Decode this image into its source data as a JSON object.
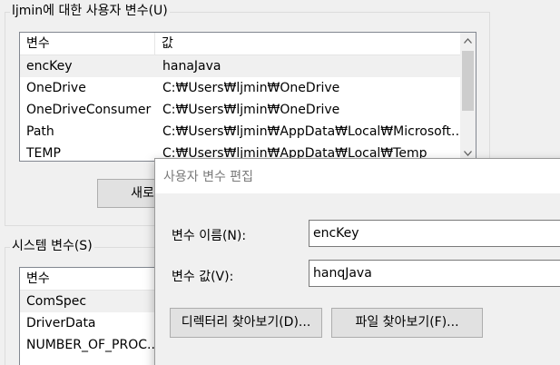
{
  "user_vars": {
    "group_title": "ljmin에 대한 사용자 변수(U)",
    "columns": [
      "변수",
      "값"
    ],
    "rows": [
      {
        "name": "encKey",
        "value": "hanaJava"
      },
      {
        "name": "OneDrive",
        "value": "C:₩Users₩ljmin₩OneDrive"
      },
      {
        "name": "OneDriveConsumer",
        "value": "C:₩Users₩ljmin₩OneDrive"
      },
      {
        "name": "Path",
        "value": "C:₩Users₩ljmin₩AppData₩Local₩Microsoft₩..."
      },
      {
        "name": "TEMP",
        "value": "C:₩Users₩ljmin₩AppData₩Local₩Temp"
      }
    ],
    "new_button": "새로"
  },
  "system_vars": {
    "group_title": "시스템 변수(S)",
    "columns": [
      "변수"
    ],
    "rows": [
      {
        "name": "ComSpec"
      },
      {
        "name": "DriverData"
      },
      {
        "name": "NUMBER_OF_PROC..."
      }
    ]
  },
  "dialog": {
    "title": "사용자 변수 편집",
    "name_label": "변수 이름(N):",
    "name_value": "encKey",
    "value_label": "변수 값(V):",
    "value_value": "hanqJava",
    "browse_dir_button": "디렉터리 찾아보기(D)...",
    "browse_file_button": "파일 찾아보기(F)..."
  },
  "icons": {
    "scroll_up": "chevron-up-icon",
    "scroll_down": "chevron-down-icon"
  },
  "colors": {
    "window_bg": "#f0f0f0",
    "selected_row": "#f0f0f0",
    "dialog_title_text": "#7a7a7a"
  }
}
